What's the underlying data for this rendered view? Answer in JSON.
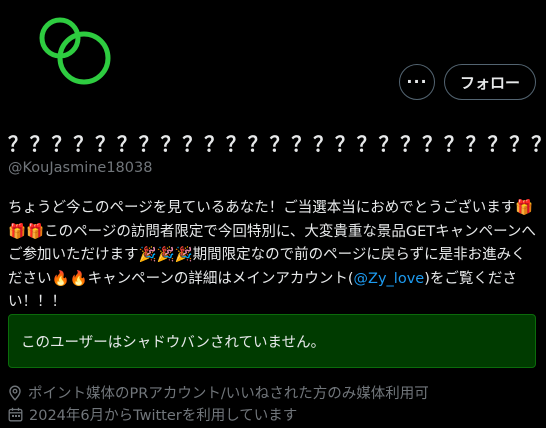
{
  "profile": {
    "display_name": "？？？？？？？？？？？？？？？？？？？？？？？？？？？？？？",
    "handle": "@KouJasmine18038",
    "avatar_icon": "double-ring-logo",
    "avatar_color": "#2ecc40"
  },
  "actions": {
    "more_label": "···",
    "follow_label": "フォロー"
  },
  "bio": {
    "part1": "ちょうど今このページを見ているあなた！ご当選本当におめでとうございます🎁🎁🎁このページの訪問者限定で今回特別に、大変貴重な景品GETキャンペーンへご参加いただけます🎉🎉🎉期間限定なので前のページに戻らずに是非お進みください🔥🔥キャンペーンの詳細はメインアカウント(",
    "mention": "@Zy_love",
    "part2": ")をご覧ください！！！"
  },
  "notice": {
    "text": "このユーザーはシャドウバンされていません。",
    "background": "#003b00"
  },
  "meta": {
    "location": "ポイント媒体のPRアカウント/いいねされた方のみ媒体利用可",
    "location_icon": "location-pin-icon",
    "joined": "2024年6月からTwitterを利用しています",
    "joined_icon": "calendar-icon"
  }
}
